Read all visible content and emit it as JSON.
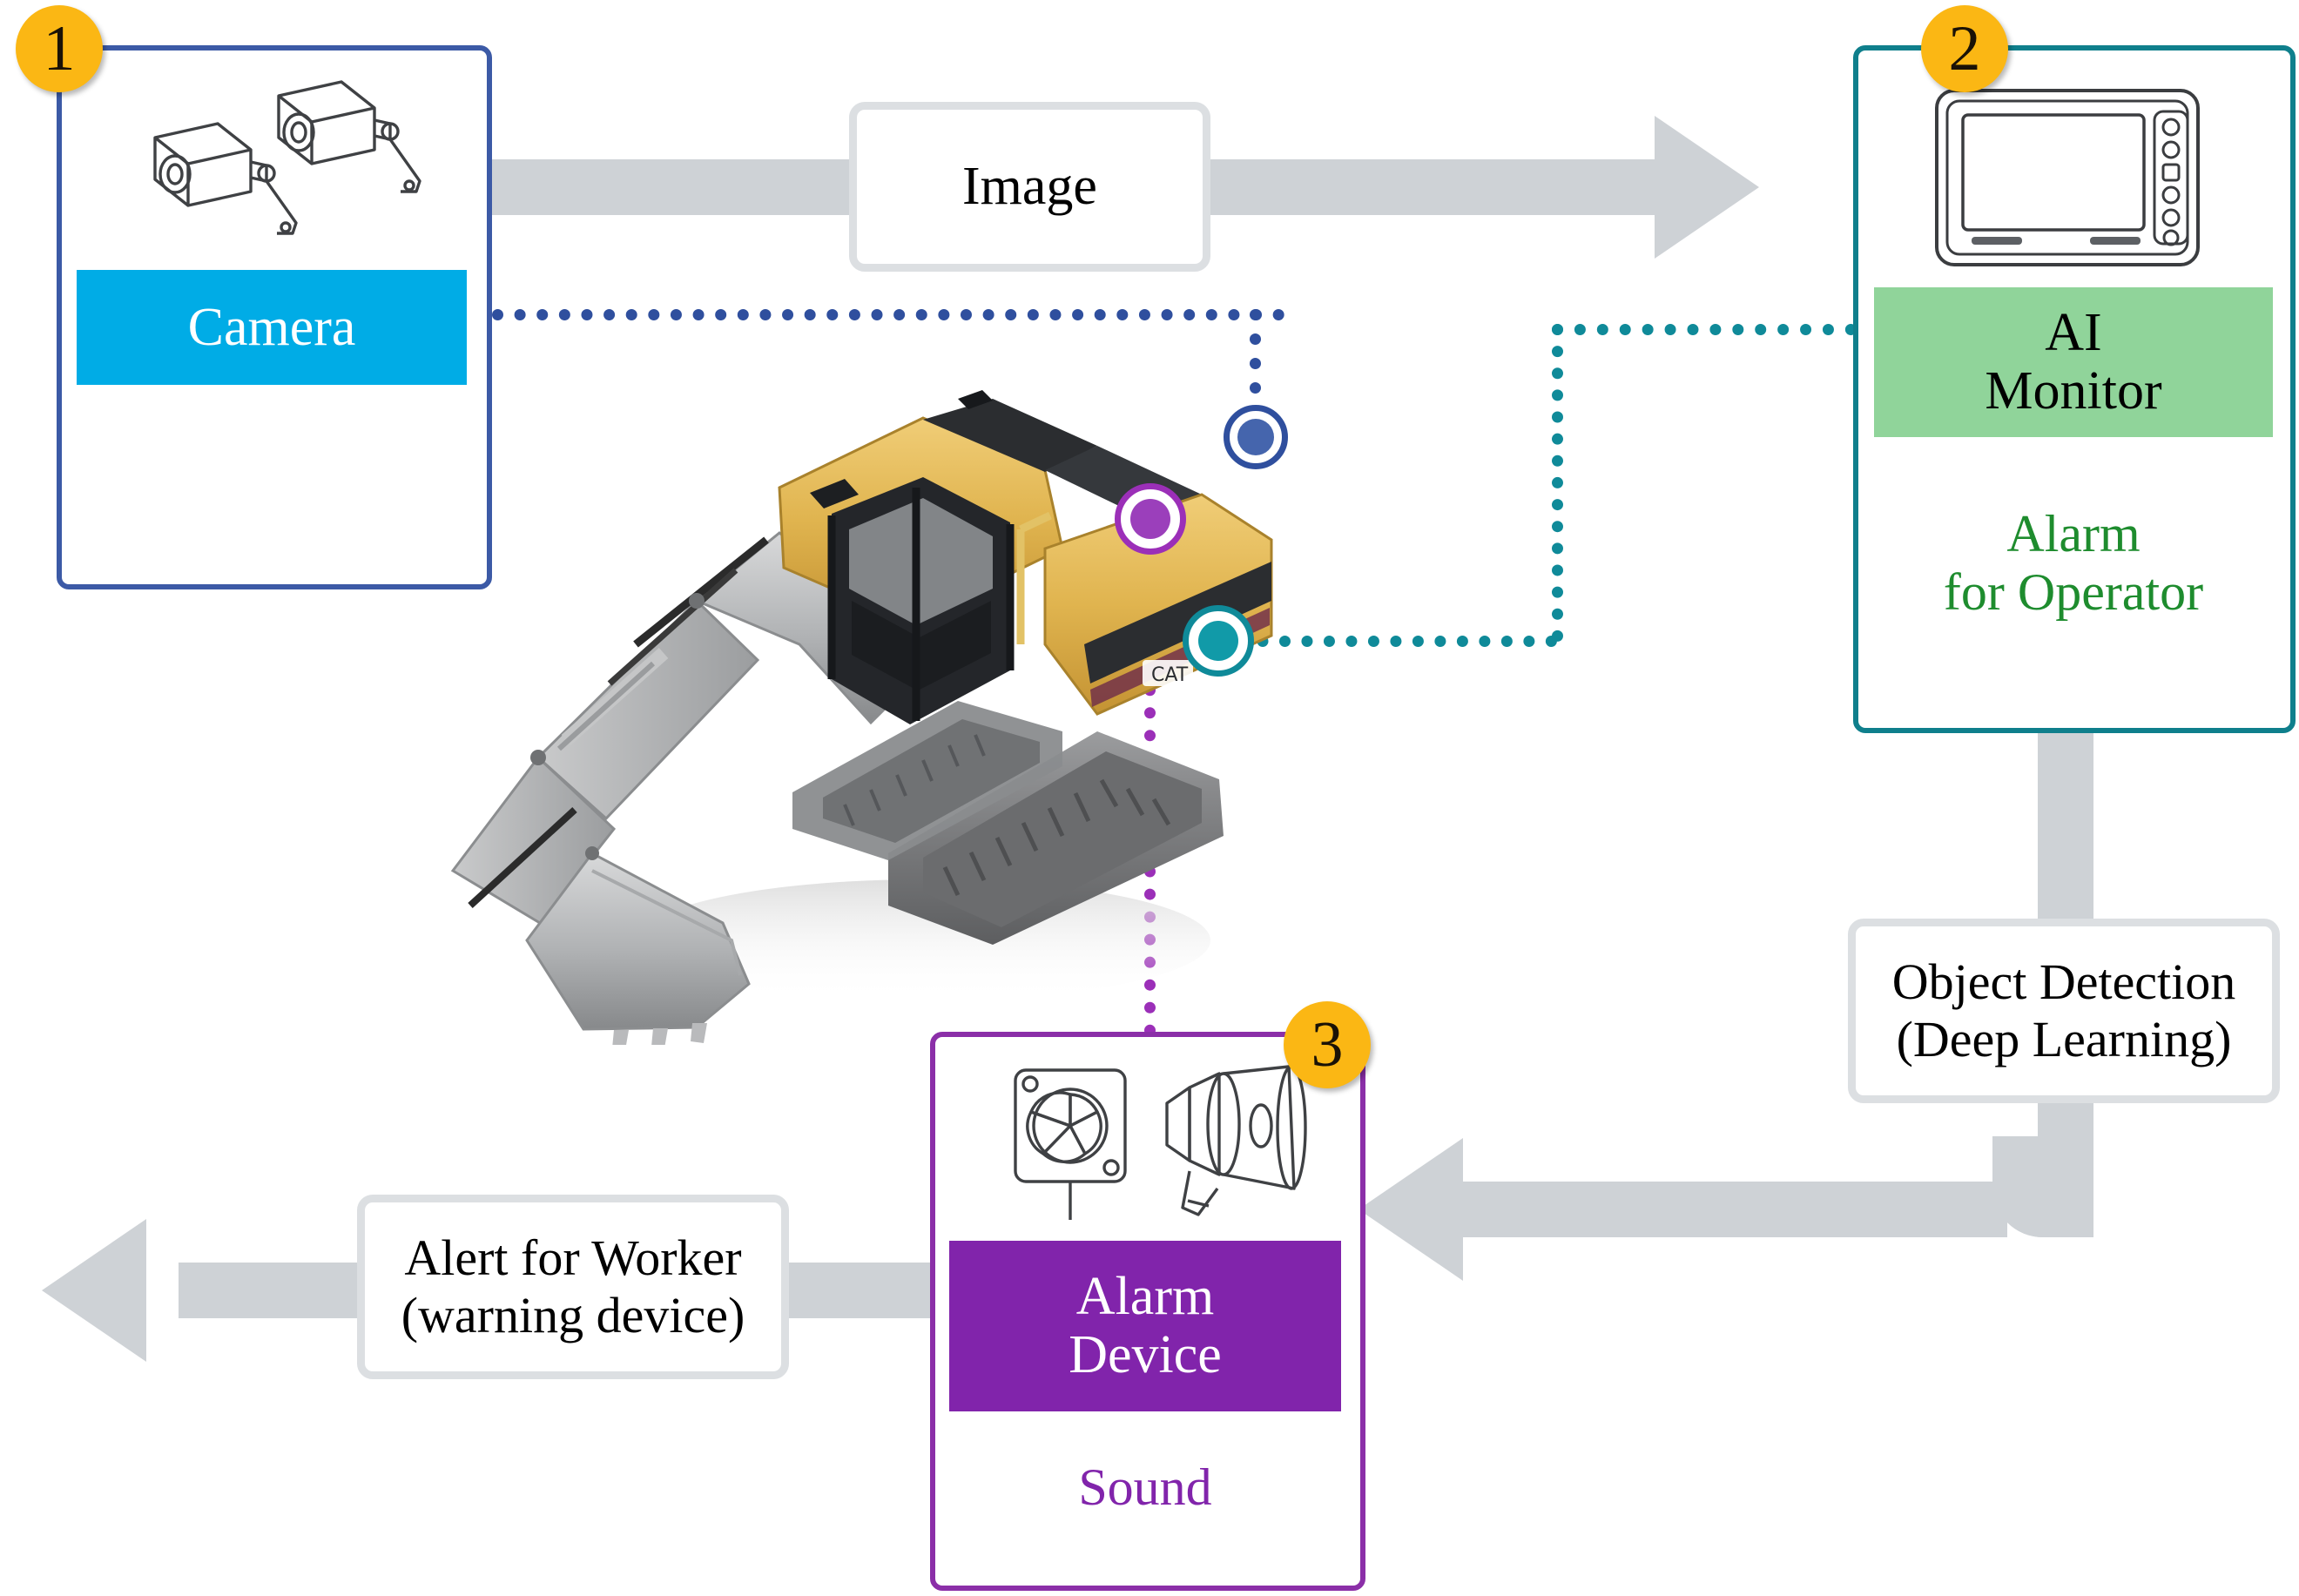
{
  "diagram": {
    "title": "Construction machine AI safety system flow",
    "colors": {
      "camera_accent": "#00ace6",
      "camera_border": "#3c5aa6",
      "monitor_accent": "#90d49a",
      "monitor_border": "#0f7f8c",
      "monitor_caption": "#1e8c2e",
      "alarm_accent": "#8124ab",
      "alarm_border": "#8b2fa8",
      "badge": "#fbb714",
      "arrow_gray": "#ced2d6",
      "label_box_border": "#dcdfe2"
    }
  },
  "nodes": {
    "camera": {
      "number": "1",
      "label": "Camera",
      "icon": "cctv-camera-pair-icon"
    },
    "monitor": {
      "number": "2",
      "label": "AI\nMonitor",
      "label_line1": "AI",
      "label_line2": "Monitor",
      "caption_line1": "Alarm",
      "caption_line2": "for Operator",
      "icon": "display-monitor-icon"
    },
    "alarm": {
      "number": "3",
      "label_line1": "Alarm",
      "label_line2": "Device",
      "caption": "Sound",
      "icon": "siren-horn-speaker-icon"
    },
    "machine": {
      "icon": "excavator-photo"
    }
  },
  "flow_labels": {
    "image": "Image",
    "object_detection_line1": "Object Detection",
    "object_detection_line2": "(Deep Learning)",
    "alert_line1": "Alert for Worker",
    "alert_line2": "(warning device)"
  },
  "markers": [
    {
      "name": "camera-mount-marker",
      "color": "#4565ad",
      "links_to": "camera"
    },
    {
      "name": "alarm-mount-marker",
      "color": "#9b3fbb",
      "links_to": "alarm"
    },
    {
      "name": "monitor-mount-marker",
      "color": "#119aa8",
      "links_to": "monitor"
    }
  ]
}
